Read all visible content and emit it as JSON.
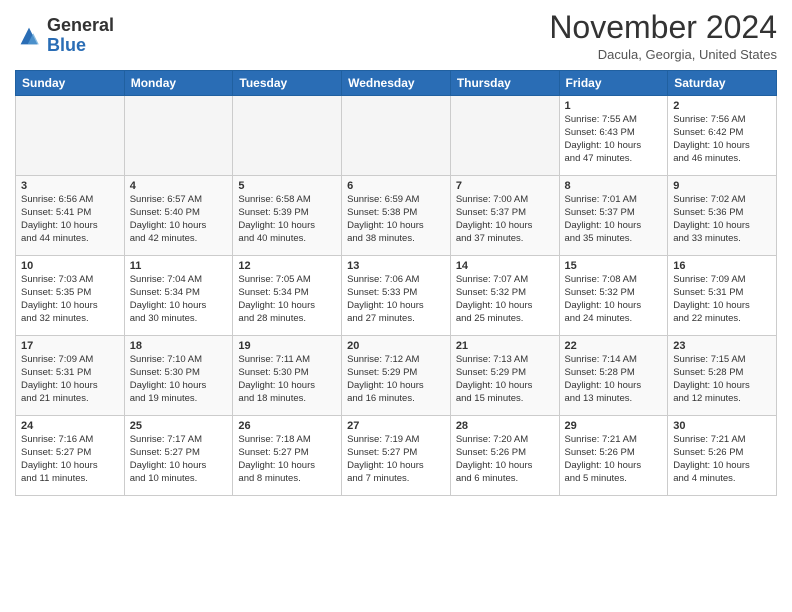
{
  "header": {
    "logo_line1": "General",
    "logo_line2": "Blue",
    "month": "November 2024",
    "location": "Dacula, Georgia, United States"
  },
  "weekdays": [
    "Sunday",
    "Monday",
    "Tuesday",
    "Wednesday",
    "Thursday",
    "Friday",
    "Saturday"
  ],
  "weeks": [
    [
      {
        "day": "",
        "info": ""
      },
      {
        "day": "",
        "info": ""
      },
      {
        "day": "",
        "info": ""
      },
      {
        "day": "",
        "info": ""
      },
      {
        "day": "",
        "info": ""
      },
      {
        "day": "1",
        "info": "Sunrise: 7:55 AM\nSunset: 6:43 PM\nDaylight: 10 hours\nand 47 minutes."
      },
      {
        "day": "2",
        "info": "Sunrise: 7:56 AM\nSunset: 6:42 PM\nDaylight: 10 hours\nand 46 minutes."
      }
    ],
    [
      {
        "day": "3",
        "info": "Sunrise: 6:56 AM\nSunset: 5:41 PM\nDaylight: 10 hours\nand 44 minutes."
      },
      {
        "day": "4",
        "info": "Sunrise: 6:57 AM\nSunset: 5:40 PM\nDaylight: 10 hours\nand 42 minutes."
      },
      {
        "day": "5",
        "info": "Sunrise: 6:58 AM\nSunset: 5:39 PM\nDaylight: 10 hours\nand 40 minutes."
      },
      {
        "day": "6",
        "info": "Sunrise: 6:59 AM\nSunset: 5:38 PM\nDaylight: 10 hours\nand 38 minutes."
      },
      {
        "day": "7",
        "info": "Sunrise: 7:00 AM\nSunset: 5:37 PM\nDaylight: 10 hours\nand 37 minutes."
      },
      {
        "day": "8",
        "info": "Sunrise: 7:01 AM\nSunset: 5:37 PM\nDaylight: 10 hours\nand 35 minutes."
      },
      {
        "day": "9",
        "info": "Sunrise: 7:02 AM\nSunset: 5:36 PM\nDaylight: 10 hours\nand 33 minutes."
      }
    ],
    [
      {
        "day": "10",
        "info": "Sunrise: 7:03 AM\nSunset: 5:35 PM\nDaylight: 10 hours\nand 32 minutes."
      },
      {
        "day": "11",
        "info": "Sunrise: 7:04 AM\nSunset: 5:34 PM\nDaylight: 10 hours\nand 30 minutes."
      },
      {
        "day": "12",
        "info": "Sunrise: 7:05 AM\nSunset: 5:34 PM\nDaylight: 10 hours\nand 28 minutes."
      },
      {
        "day": "13",
        "info": "Sunrise: 7:06 AM\nSunset: 5:33 PM\nDaylight: 10 hours\nand 27 minutes."
      },
      {
        "day": "14",
        "info": "Sunrise: 7:07 AM\nSunset: 5:32 PM\nDaylight: 10 hours\nand 25 minutes."
      },
      {
        "day": "15",
        "info": "Sunrise: 7:08 AM\nSunset: 5:32 PM\nDaylight: 10 hours\nand 24 minutes."
      },
      {
        "day": "16",
        "info": "Sunrise: 7:09 AM\nSunset: 5:31 PM\nDaylight: 10 hours\nand 22 minutes."
      }
    ],
    [
      {
        "day": "17",
        "info": "Sunrise: 7:09 AM\nSunset: 5:31 PM\nDaylight: 10 hours\nand 21 minutes."
      },
      {
        "day": "18",
        "info": "Sunrise: 7:10 AM\nSunset: 5:30 PM\nDaylight: 10 hours\nand 19 minutes."
      },
      {
        "day": "19",
        "info": "Sunrise: 7:11 AM\nSunset: 5:30 PM\nDaylight: 10 hours\nand 18 minutes."
      },
      {
        "day": "20",
        "info": "Sunrise: 7:12 AM\nSunset: 5:29 PM\nDaylight: 10 hours\nand 16 minutes."
      },
      {
        "day": "21",
        "info": "Sunrise: 7:13 AM\nSunset: 5:29 PM\nDaylight: 10 hours\nand 15 minutes."
      },
      {
        "day": "22",
        "info": "Sunrise: 7:14 AM\nSunset: 5:28 PM\nDaylight: 10 hours\nand 13 minutes."
      },
      {
        "day": "23",
        "info": "Sunrise: 7:15 AM\nSunset: 5:28 PM\nDaylight: 10 hours\nand 12 minutes."
      }
    ],
    [
      {
        "day": "24",
        "info": "Sunrise: 7:16 AM\nSunset: 5:27 PM\nDaylight: 10 hours\nand 11 minutes."
      },
      {
        "day": "25",
        "info": "Sunrise: 7:17 AM\nSunset: 5:27 PM\nDaylight: 10 hours\nand 10 minutes."
      },
      {
        "day": "26",
        "info": "Sunrise: 7:18 AM\nSunset: 5:27 PM\nDaylight: 10 hours\nand 8 minutes."
      },
      {
        "day": "27",
        "info": "Sunrise: 7:19 AM\nSunset: 5:27 PM\nDaylight: 10 hours\nand 7 minutes."
      },
      {
        "day": "28",
        "info": "Sunrise: 7:20 AM\nSunset: 5:26 PM\nDaylight: 10 hours\nand 6 minutes."
      },
      {
        "day": "29",
        "info": "Sunrise: 7:21 AM\nSunset: 5:26 PM\nDaylight: 10 hours\nand 5 minutes."
      },
      {
        "day": "30",
        "info": "Sunrise: 7:21 AM\nSunset: 5:26 PM\nDaylight: 10 hours\nand 4 minutes."
      }
    ]
  ]
}
